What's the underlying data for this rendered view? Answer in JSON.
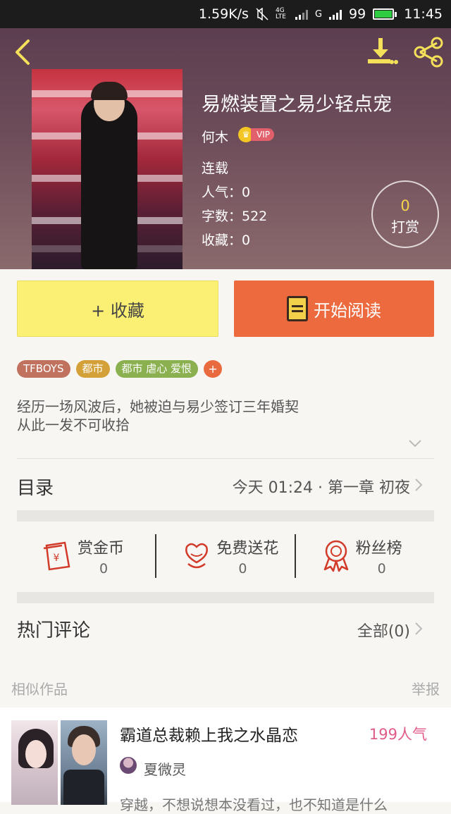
{
  "status_bar": {
    "speed": "1.59K/s",
    "network_1": "4G LTE",
    "network_2": "G",
    "battery": "99",
    "time": "11:45"
  },
  "book": {
    "title": "易燃装置之易少轻点宠",
    "author": "何木",
    "vip_label": "VIP",
    "status": "连载",
    "popularity": "人气：0",
    "word_count": "字数：522",
    "favorites": "收藏：0"
  },
  "reward": {
    "count": "0",
    "label": "打赏"
  },
  "actions": {
    "favorite_label": "+ 收藏",
    "read_label": "开始阅读"
  },
  "tags": [
    {
      "label": "TFBOYS",
      "color": "#c0725f"
    },
    {
      "label": "都市",
      "color": "#d4a038"
    },
    {
      "label": "都市  虐心  爱恨",
      "color": "#8ab04f"
    }
  ],
  "tag_add": "+",
  "description": [
    "经历一场风波后，她被迫与易少签订三年婚契",
    "从此一发不可收拾"
  ],
  "catalog": {
    "label": "目录",
    "latest": "今天 01:24 · 第一章   初夜"
  },
  "stats": [
    {
      "name": "赏金币",
      "value": "0",
      "icon": "red-envelope-icon"
    },
    {
      "name": "免费送花",
      "value": "0",
      "icon": "flower-icon"
    },
    {
      "name": "粉丝榜",
      "value": "0",
      "icon": "ribbon-medal-icon"
    }
  ],
  "comments": {
    "label": "热门评论",
    "all": "全部(0)"
  },
  "similar": {
    "label": "相似作品",
    "report": "举报"
  },
  "similar_item": {
    "title": "霸道总裁赖上我之水晶恋",
    "popularity": "199人气",
    "author": "夏微灵",
    "desc": "穿越，不想说想本没看过，也不知道是什么"
  },
  "colors": {
    "accent_orange": "#ec6a3d",
    "favorite_yellow": "#fbf073",
    "popularity_pink": "#e05a8a"
  }
}
